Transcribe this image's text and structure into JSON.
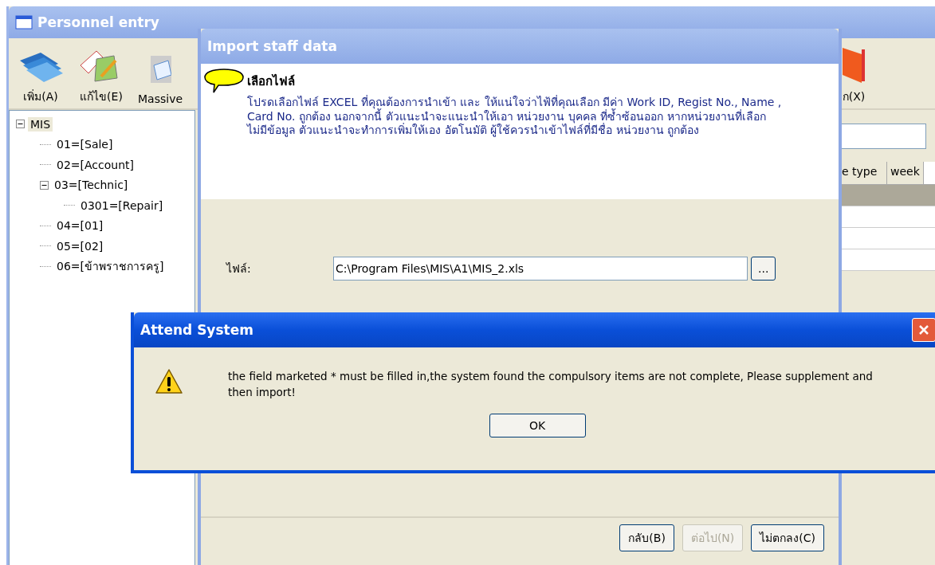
{
  "main_window": {
    "title": "Personnel entry",
    "toolbar": [
      {
        "kind": "add",
        "label": "เพิ่ม(A)"
      },
      {
        "kind": "edit",
        "label": "แก้ไข(E)"
      },
      {
        "kind": "import",
        "label": "Massive"
      },
      {
        "kind": "exit",
        "label": "ก(X)"
      }
    ],
    "tree": [
      {
        "label": "MIS",
        "selected": true,
        "expanded": true,
        "children": [
          {
            "label": "01=[Sale]",
            "selected": false
          },
          {
            "label": "02=[Account]",
            "selected": false
          },
          {
            "label": "03=[Technic]",
            "selected": false,
            "expanded": true,
            "children": [
              {
                "label": "0301=[Repair]",
                "selected": false
              }
            ]
          },
          {
            "label": "04=[01]",
            "selected": false
          },
          {
            "label": "05=[02]",
            "selected": false
          },
          {
            "label": "06=[ข้าพราชการครู]",
            "selected": false
          }
        ]
      }
    ],
    "table": {
      "columns": [
        "e type",
        "week"
      ],
      "rows": [
        {
          "selected": true
        },
        {
          "selected": false
        },
        {
          "selected": false
        },
        {
          "selected": false
        }
      ]
    }
  },
  "import_dialog": {
    "title": "Import staff data",
    "heading": "เลือกไฟล์",
    "description": "โปรดเลือกไฟล์ EXCEL ที่คุณต้องการนำเข้า และ ให้แน่ใจว่าไฟ้ที่คุณเลือก มีค่า Work ID, Regist No., Name , Card No. ถูกต้อง นอกจากนี้ ตัวแนะนำจะแนะนำให้เอา หน่วยงาน บุคคล ที่ซ้ำซ้อนออก หากหน่วยงานที่เลือก ไม่มีข้อมูล ตัวแนะนำจะทำการเพิ่มให้เอง อัตโนมัติ ผู้ใช้ควรนำเข้าไฟล์ที่มีชื่อ หน่วยงาน ถูกต้อง",
    "file_label": "ไฟล์:",
    "file_value": "C:\\Program Files\\MIS\\A1\\MIS_2.xls",
    "browse": "...",
    "buttons": [
      {
        "label": "กลับ(B)",
        "disabled": false
      },
      {
        "label": "ต่อไป(N)",
        "disabled": true
      },
      {
        "label": "ไม่ตกลง(C)",
        "disabled": false
      }
    ]
  },
  "message_box": {
    "title": "Attend System",
    "message": "the field marketed * must be filled in,the system found the compulsory items are  not complete, Please supplement and then import!",
    "button": "OK"
  }
}
